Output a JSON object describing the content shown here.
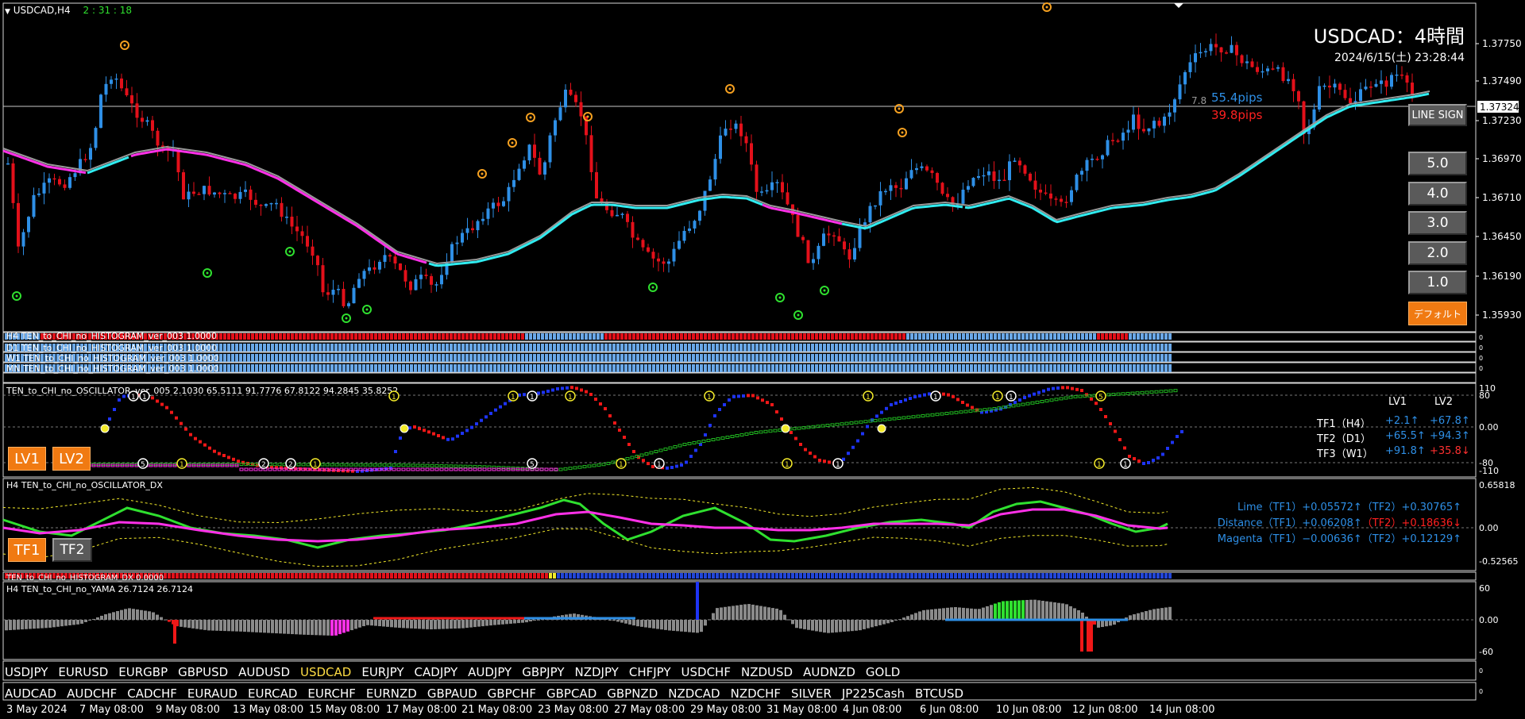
{
  "window": {
    "symbol_tf": "USDCAD,H4",
    "timer": "2 : 31 : 18",
    "title": "USDCAD：4時間",
    "datetime": "2024/6/15(土) 23:28:44"
  },
  "colors": {
    "bull": "#2e8fe6",
    "bear": "#e3101a",
    "magenta": "#ff30e8",
    "cyan": "#30ecf0",
    "lime": "#2fe02f",
    "orange": "#f5a020",
    "yellow": "#f3ea2a",
    "blue_dot": "#1e34f5",
    "red_dot": "#f01818",
    "green_dot": "#1fb51f"
  },
  "main": {
    "price_axis": [
      "1.37750",
      "1.37490",
      "1.37230",
      "1.36970",
      "1.36710",
      "1.36450",
      "1.36190",
      "1.35930"
    ],
    "current_price": "1.37324",
    "spread_marker": "7.8",
    "pips_up": "55.4pips",
    "pips_down": "39.8pips"
  },
  "buttons": {
    "line_sign": "LINE SIGN",
    "levels": [
      "5.0",
      "4.0",
      "3.0",
      "2.0",
      "1.0"
    ],
    "default": "デフォルト",
    "lv1": "LV1",
    "lv2": "LV2",
    "tf1": "TF1",
    "tf2": "TF2"
  },
  "histograms": {
    "h4": "H4 TEN_to_CHI_no_HISTOGRAM_ver_003 1.0000",
    "d1": "D1 TEN_to_CHI_no_HISTOGRAM_ver_003 1.0000",
    "w1": "W1 TEN_to_CHI_no_HISTOGRAM_ver_003 1.0000",
    "mn": "MN TEN_to_CHI_no_HISTOGRAM_ver_003 1.0000",
    "dx": "TEN_to_CHI_no_HISTOGRAM_DX 0.0000"
  },
  "oscillator": {
    "label": "TEN_to_CHI_no_OSCILLATOR_ver_005 2.1030 65.5111 91.7776 67.8122 94.2845 35.8252",
    "axis": [
      "110",
      "80",
      "0.00",
      "-80",
      "-110"
    ],
    "col_lv1": "LV1",
    "col_lv2": "LV2",
    "rows": [
      {
        "name": "TF1（H4）",
        "lv1": "+2.1",
        "lv1_dir": "↑",
        "lv2": "+67.8",
        "lv2_dir": "↑"
      },
      {
        "name": "TF2（D1）",
        "lv1": "+65.5",
        "lv1_dir": "↑",
        "lv2": "+94.3",
        "lv2_dir": "↑"
      },
      {
        "name": "TF3（W1）",
        "lv1": "+91.8",
        "lv1_dir": "↑",
        "lv2": "+35.8",
        "lv2_dir": "↓"
      }
    ]
  },
  "dx": {
    "label": "H4 TEN_to_CHI_no_OSCILLATOR_DX",
    "axis": [
      "0.65818",
      "0.00",
      "-0.52565"
    ],
    "lime": "Lime（TF1）+0.05572↑（TF2）+0.30765↑",
    "distance_a": "Distance（TF1）+0.06208↑",
    "distance_b": "（TF2）+0.18636↓",
    "magenta": "Magenta（TF1）−0.00636↑（TF2）+0.12129↑"
  },
  "yama": {
    "label": "H4  TEN_to_CHI_no_YAMA 26.7124 26.7124",
    "axis": [
      "60",
      "0.00",
      "-60"
    ]
  },
  "symbols_row1": [
    "USDJPY",
    "EURUSD",
    "EURGBP",
    "GBPUSD",
    "AUDUSD",
    "USDCAD",
    "EURJPY",
    "CADJPY",
    "AUDJPY",
    "GBPJPY",
    "NZDJPY",
    "CHFJPY",
    "USDCHF",
    "NZDUSD",
    "AUDNZD",
    "GOLD"
  ],
  "symbols_row2": [
    "AUDCAD",
    "AUDCHF",
    "CADCHF",
    "EURAUD",
    "EURCAD",
    "EURCHF",
    "EURNZD",
    "GBPAUD",
    "GBPCHF",
    "GBPCAD",
    "GBPNZD",
    "NZDCAD",
    "NZDCHF",
    "SILVER",
    "JP225Cash",
    "BTCUSD"
  ],
  "active_symbol": "USDCAD",
  "time_axis": [
    "3 May 2024",
    "7 May 08:00",
    "9 May 08:00",
    "13 May 08:00",
    "15 May 08:00",
    "17 May 08:00",
    "21 May 08:00",
    "23 May 08:00",
    "27 May 08:00",
    "29 May 08:00",
    "31 May 08:00",
    "4 Jun 08:00",
    "6 Jun 08:00",
    "10 Jun 08:00",
    "12 Jun 08:00",
    "14 Jun 08:00"
  ]
}
